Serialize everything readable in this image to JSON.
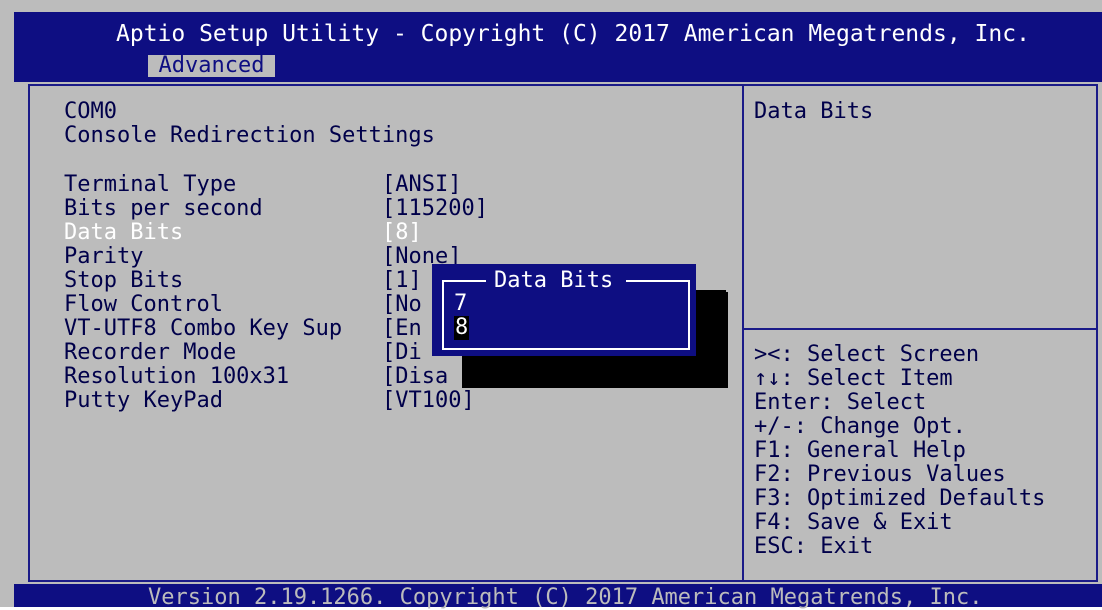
{
  "header": {
    "title": "Aptio Setup Utility - Copyright (C) 2017 American Megatrends, Inc.",
    "active_tab": "Advanced"
  },
  "left_panel": {
    "heading1": "COM0",
    "heading2": "Console Redirection Settings",
    "settings": [
      {
        "label": "Terminal Type",
        "value": "[ANSI]"
      },
      {
        "label": "Bits per second",
        "value": "[115200]"
      },
      {
        "label": "Data Bits",
        "value": "[8]"
      },
      {
        "label": "Parity",
        "value": "[None]"
      },
      {
        "label": "Stop Bits",
        "value": "[1]"
      },
      {
        "label": "Flow Control",
        "value": "[No"
      },
      {
        "label": "VT-UTF8 Combo Key Sup",
        "value": "[En"
      },
      {
        "label": "Recorder Mode",
        "value": "[Di"
      },
      {
        "label": "Resolution 100x31",
        "value": "[Disa"
      },
      {
        "label": "Putty KeyPad",
        "value": "[VT100]"
      }
    ]
  },
  "popup": {
    "title": "Data Bits",
    "options": [
      "7",
      "8"
    ],
    "selected": "8"
  },
  "help_panel": {
    "title": "Data Bits",
    "keys": [
      "><: Select Screen",
      "↑↓: Select Item",
      "Enter: Select",
      "+/-: Change Opt.",
      "F1: General Help",
      "F2: Previous Values",
      "F3: Optimized Defaults",
      "F4: Save & Exit",
      "ESC: Exit"
    ]
  },
  "footer": {
    "text": "Version 2.19.1266. Copyright (C) 2017 American Megatrends, Inc."
  },
  "colors": {
    "bar": "#0e0e82",
    "panel": "#bcbcbc",
    "text": "#00004a",
    "highlight": "#ffffff"
  }
}
